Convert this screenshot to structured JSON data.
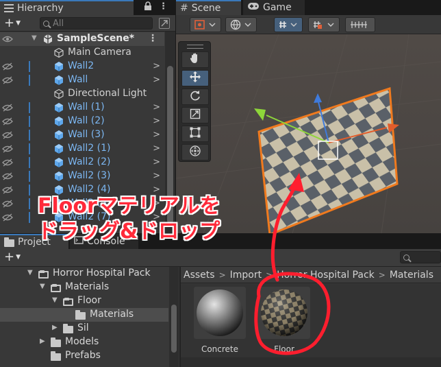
{
  "hierarchy": {
    "tab_label": "Hierarchy",
    "search_placeholder": "All",
    "scene_name": "SampleScene*",
    "items": [
      {
        "label": "Main Camera",
        "kind": "gameobject"
      },
      {
        "label": "Wall2",
        "kind": "prefab"
      },
      {
        "label": "Wall",
        "kind": "prefab"
      },
      {
        "label": "Directional Light",
        "kind": "gameobject"
      },
      {
        "label": "Wall (1)",
        "kind": "prefab"
      },
      {
        "label": "Wall (2)",
        "kind": "prefab"
      },
      {
        "label": "Wall (3)",
        "kind": "prefab"
      },
      {
        "label": "Wall2 (1)",
        "kind": "prefab"
      },
      {
        "label": "Wall2 (2)",
        "kind": "prefab"
      },
      {
        "label": "Wall2 (3)",
        "kind": "prefab"
      },
      {
        "label": "Wall2 (4)",
        "kind": "prefab"
      },
      {
        "label": "Wall2 (5)",
        "kind": "prefab"
      },
      {
        "label": "Wall2 (7)",
        "kind": "prefab"
      }
    ]
  },
  "scene": {
    "scene_tab_label": "Scene",
    "game_tab_label": "Game",
    "tools": [
      "hand-tool",
      "move-tool",
      "rotate-tool",
      "scale-tool",
      "rect-tool",
      "transform-tool"
    ],
    "active_tool": "move-tool"
  },
  "project": {
    "project_tab_label": "Project",
    "console_tab_label": "Console",
    "tree": [
      {
        "label": "Horror Hospital Pack",
        "foldout": "open",
        "folder": "open"
      },
      {
        "label": "Materials",
        "foldout": "open",
        "folder": "open"
      },
      {
        "label": "Floor",
        "foldout": "open",
        "folder": "open"
      },
      {
        "label": "Materials",
        "foldout": "none",
        "folder": "closed",
        "selected": true
      },
      {
        "label": "Sil",
        "foldout": "closed",
        "folder": "closed"
      },
      {
        "label": "Models",
        "foldout": "closed",
        "folder": "closed"
      },
      {
        "label": "Prefabs",
        "foldout": "none",
        "folder": "closed"
      }
    ],
    "breadcrumb": [
      "Assets",
      "Import",
      "Horror Hospital Pack",
      "Materials"
    ],
    "assets": [
      {
        "name": "Concrete"
      },
      {
        "name": "Floor"
      }
    ]
  },
  "annotation": {
    "line1": "Floorマテリアルを",
    "line2": "ドラッグ&ドロップ",
    "color": "#ff1e2e"
  }
}
